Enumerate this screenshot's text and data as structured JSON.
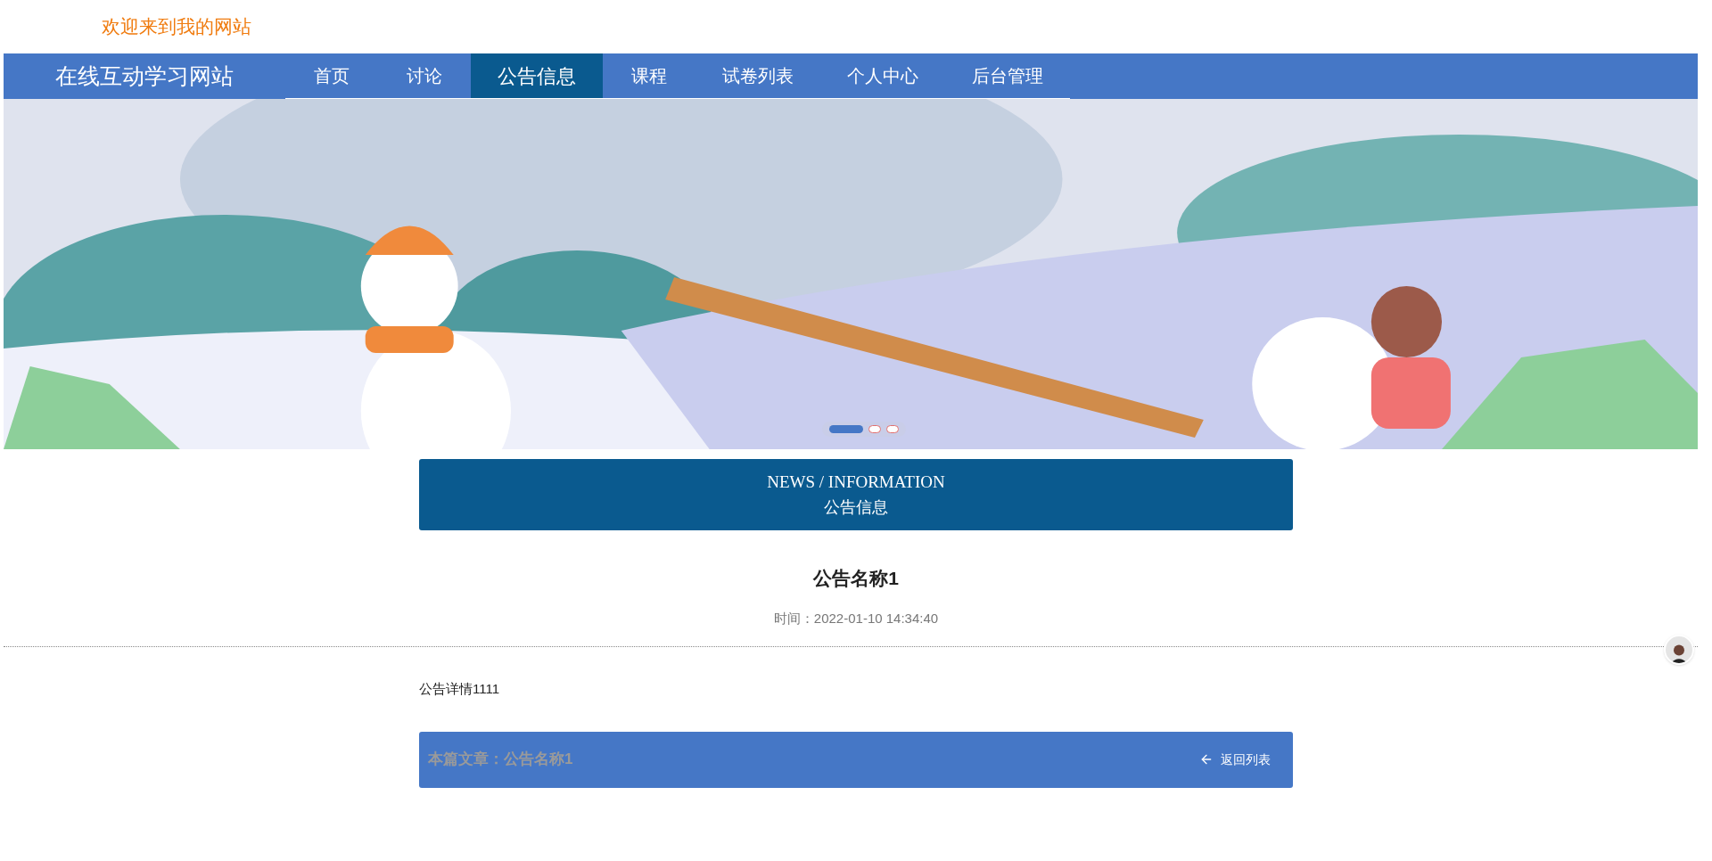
{
  "welcome": "欢迎来到我的网站",
  "site_title": "在线互动学习网站",
  "nav": [
    {
      "label": "首页",
      "selected": false
    },
    {
      "label": "讨论",
      "selected": false
    },
    {
      "label": "公告信息",
      "selected": true
    },
    {
      "label": "课程",
      "selected": false
    },
    {
      "label": "试卷列表",
      "selected": false
    },
    {
      "label": "个人中心",
      "selected": false
    },
    {
      "label": "后台管理",
      "selected": false
    }
  ],
  "banner": {
    "kind": "picture",
    "indicators": [
      {
        "selected": true
      },
      {
        "selected": false
      },
      {
        "selected": false
      }
    ]
  },
  "section_header": {
    "english": "NEWS / INFORMATION",
    "chinese": "公告信息"
  },
  "article": {
    "title": "公告名称1",
    "time_label": "时间：",
    "time": "2022-01-10 14:34:40",
    "body": "公告详情1111"
  },
  "footer_bar": {
    "current": "本篇文章：公告名称1",
    "back": "返回列表"
  }
}
